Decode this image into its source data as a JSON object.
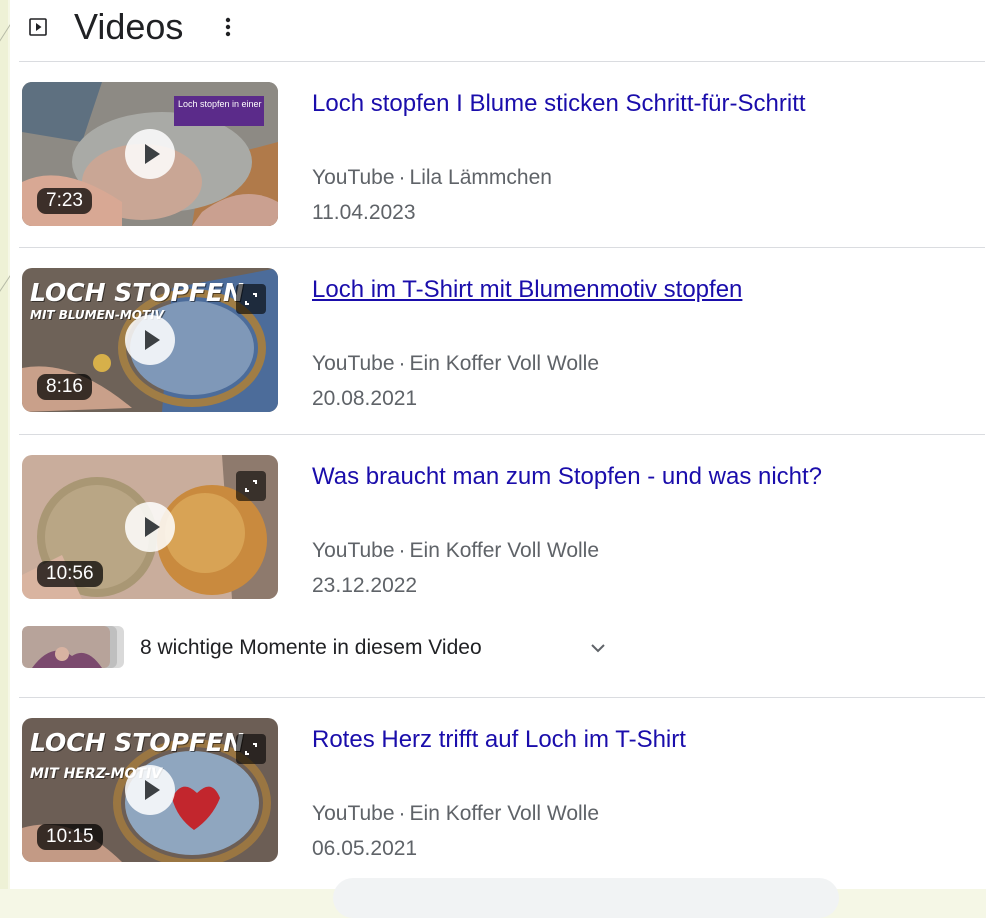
{
  "header": {
    "title": "Videos",
    "icon": "video-play-icon",
    "more_icon": "more-vert-icon"
  },
  "videos": [
    {
      "title": "Loch stopfen I Blume sticken Schritt-für-Schritt",
      "source": "YouTube",
      "separator": "·",
      "channel": "Lila Lämmchen",
      "date": "11.04.2023",
      "duration": "7:23",
      "thumb_text": "Loch stopfen in einer Blu",
      "underlined": false
    },
    {
      "title": "Loch im T-Shirt mit Blumenmotiv stopfen",
      "source": "YouTube",
      "separator": "·",
      "channel": "Ein Koffer Voll Wolle",
      "date": "20.08.2021",
      "duration": "8:16",
      "thumb_text_1": "LOCH STOPFEN",
      "thumb_text_2": "MIT BLUMEN-MOTIV",
      "underlined": true
    },
    {
      "title": "Was braucht man zum Stopfen - und was nicht?",
      "source": "YouTube",
      "separator": "·",
      "channel": "Ein Koffer Voll Wolle",
      "date": "23.12.2022",
      "duration": "10:56",
      "underlined": false
    },
    {
      "title": "Rotes Herz trifft auf Loch im T-Shirt",
      "source": "YouTube",
      "separator": "·",
      "channel": "Ein Koffer Voll Wolle",
      "date": "06.05.2021",
      "duration": "10:15",
      "thumb_text_1": "LOCH STOPFEN",
      "thumb_text_2": "MIT HERZ-MOTIV",
      "underlined": false
    }
  ],
  "key_moments": {
    "label": "8 wichtige Momente in diesem Video",
    "icon": "chevron-down-icon"
  },
  "colors": {
    "link": "#1a0dab",
    "meta": "#5f6368",
    "divider": "#dadce0"
  }
}
